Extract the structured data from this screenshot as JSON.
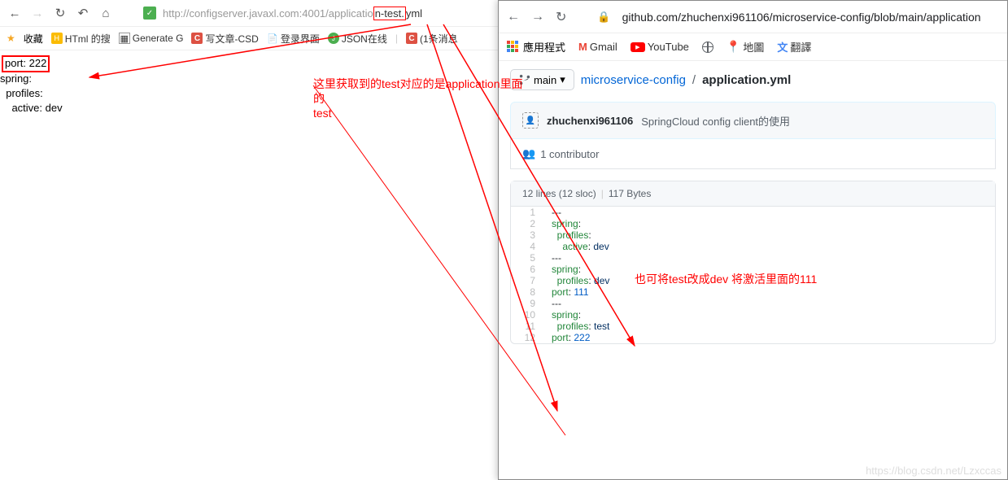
{
  "left": {
    "url_host": "http://configserver.javaxl.com:4001/applicatio",
    "url_highlight": "n-test.",
    "url_tail": "yml",
    "bookmarks": {
      "fav": "收藏",
      "html": "HTml 的搜",
      "gen": "Generate G",
      "csd": "写文章-CSD",
      "login": "登录界面",
      "json": "JSON在线",
      "msg": "(1条消息"
    },
    "code": {
      "port_line": "port: 222",
      "spring": "spring:",
      "profiles": "  profiles:",
      "active": "    active: dev"
    }
  },
  "right": {
    "url": "github.com/zhuchenxi961106/microservice-config/blob/main/application",
    "bm": {
      "apps": "應用程式",
      "gmail": "Gmail",
      "youtube": "YouTube",
      "maps": "地圖",
      "translate": "翻譯"
    },
    "branch": "main",
    "crumb_repo": "microservice-config",
    "crumb_file": "application.yml",
    "author": "zhuchenxi961106",
    "commit_msg": "SpringCloud config client的使用",
    "contributors": "1 contributor",
    "file_info_lines": "12 lines (12 sloc)",
    "file_info_bytes": "117 Bytes",
    "code": [
      {
        "n": 1,
        "raw": "---"
      },
      {
        "n": 2,
        "k": "spring",
        "c": ":"
      },
      {
        "n": 3,
        "indent": "  ",
        "k": "profiles",
        "c": ":"
      },
      {
        "n": 4,
        "indent": "    ",
        "k": "active",
        "c": ": ",
        "s": "dev"
      },
      {
        "n": 5,
        "raw": "---"
      },
      {
        "n": 6,
        "k": "spring",
        "c": ":"
      },
      {
        "n": 7,
        "indent": "  ",
        "k": "profiles",
        "c": ": ",
        "s": "dev"
      },
      {
        "n": 8,
        "k": "port",
        "c": ": ",
        "v": "111"
      },
      {
        "n": 9,
        "raw": "---"
      },
      {
        "n": 10,
        "k": "spring",
        "c": ":"
      },
      {
        "n": 11,
        "indent": "  ",
        "k": "profiles",
        "c": ": ",
        "s": "test"
      },
      {
        "n": 12,
        "k": "port",
        "c": ": ",
        "v": "222"
      }
    ]
  },
  "annotations": {
    "left_text_1": "这里获取到的test对应的是application里面的",
    "left_text_2": "test",
    "right_text": "也可将test改成dev 将激活里面的111"
  },
  "watermark": "https://blog.csdn.net/Lzxccas"
}
